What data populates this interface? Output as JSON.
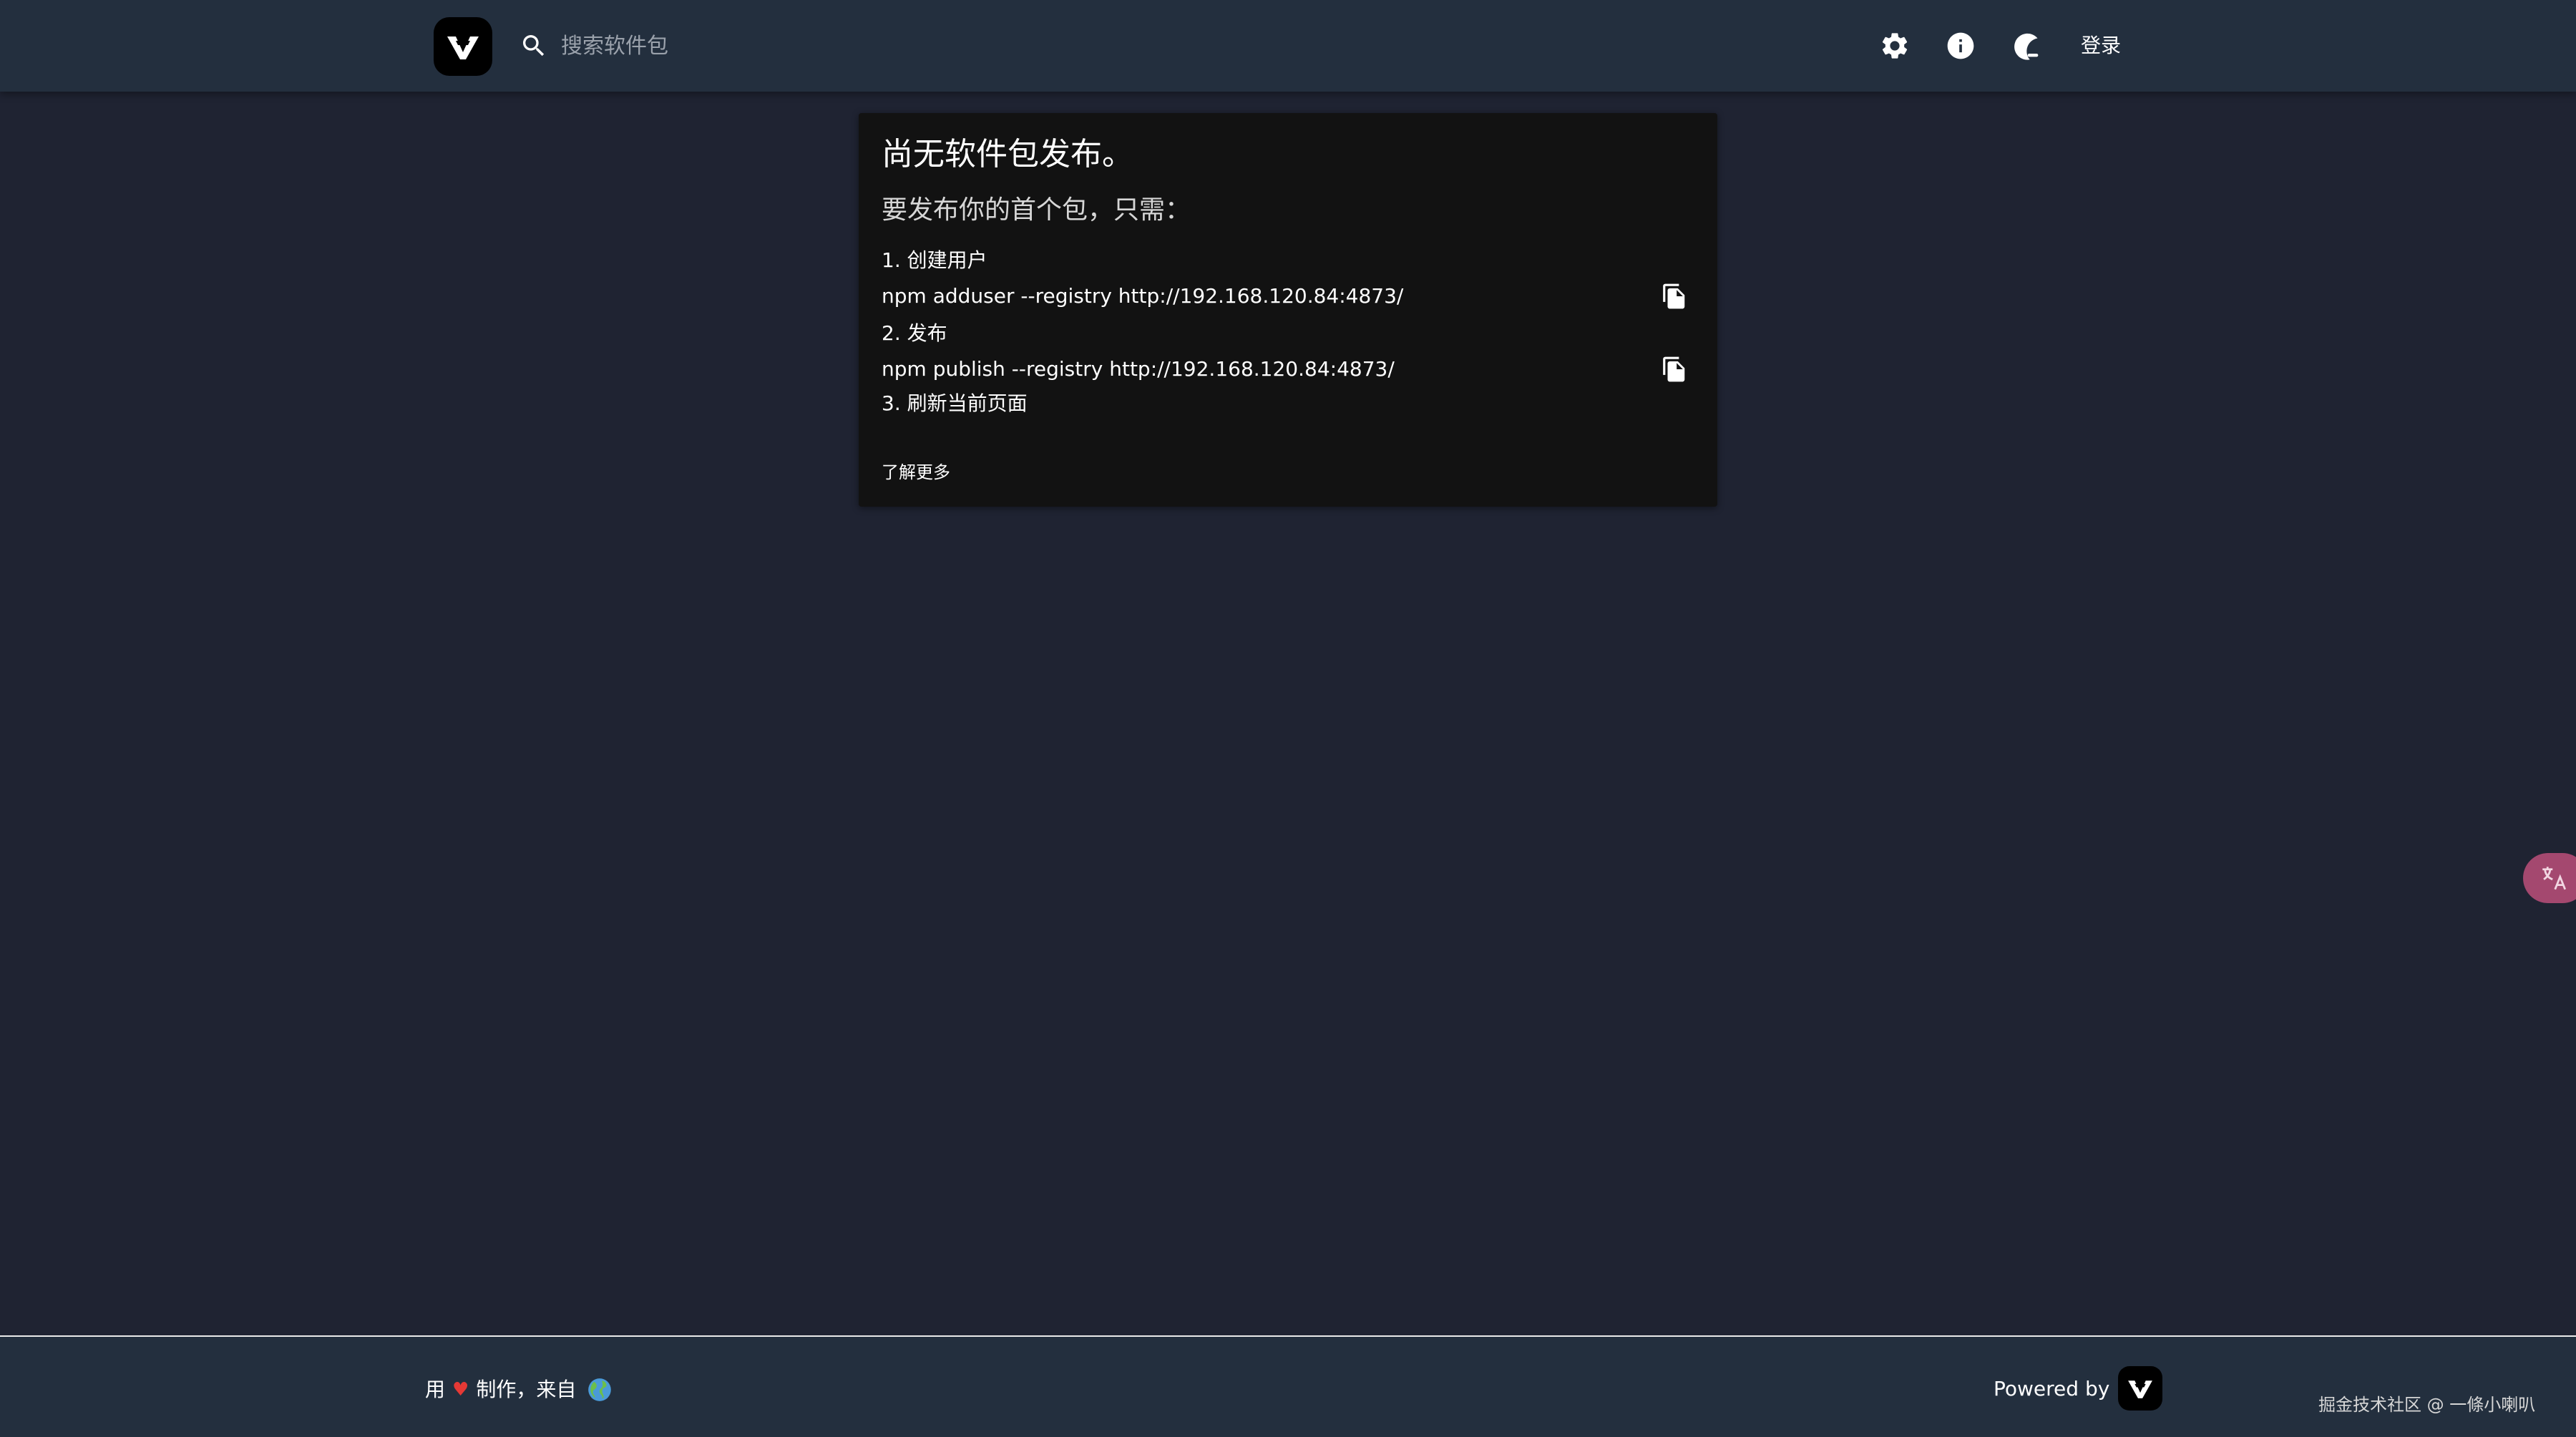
{
  "header": {
    "logo_icon": "verdaccio-logo",
    "search": {
      "placeholder": "搜索软件包",
      "value": ""
    },
    "icons": [
      "gear-icon",
      "info-icon",
      "dark-mode-icon"
    ],
    "login_label": "登录"
  },
  "card": {
    "title": "尚无软件包发布。",
    "subtitle": "要发布你的首个包，只需：",
    "steps": [
      {
        "label": "1. 创建用户",
        "command": "npm adduser --registry http://192.168.120.84:4873/"
      },
      {
        "label": "2. 发布",
        "command": "npm publish --registry http://192.168.120.84:4873/"
      },
      {
        "label": "3. 刷新当前页面"
      }
    ],
    "learn_more": "了解更多"
  },
  "translate_button": {
    "icon": "translate-icon"
  },
  "footer": {
    "made_with_prefix": "用",
    "heart": "♥",
    "made_with_suffix": "制作，来自",
    "globe_icon": "globe-icon",
    "powered_by": "Powered by",
    "watermark": "掘金技术社区 @ 一條小喇叭"
  },
  "colors": {
    "background": "#1f2332",
    "header": "#232f3e",
    "card": "#121212",
    "heart": "#e53935",
    "translate": "#a4486f"
  }
}
